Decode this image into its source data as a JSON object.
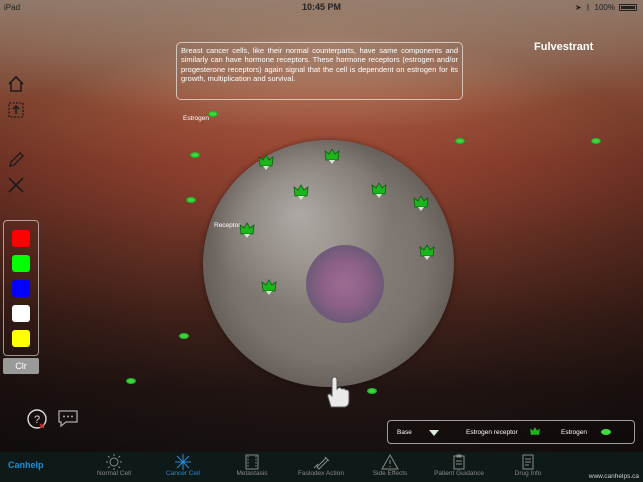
{
  "status": {
    "carrier": "iPad",
    "time": "10:45 PM",
    "battery": "100%"
  },
  "title": "Fulvestrant",
  "info_text": "Breast cancer cells, like their normal counterparts, have same components and similarly can have hormone receptors.  These hormone receptors (estrogen and/or progesterone receptors) again signal that the cell is dependent on estrogen for its growth, multiplication and survival.",
  "labels": {
    "estrogen": "Estrogen",
    "receptor": "Receptor"
  },
  "palette": {
    "colors": [
      "#ff0000",
      "#00ff00",
      "#0000ff",
      "#ffffff",
      "#ffff00"
    ],
    "clear_label": "Clr"
  },
  "legend": {
    "base": "Base",
    "receptor": "Estrogen receptor",
    "estrogen": "Estrogen"
  },
  "tabs": [
    {
      "label": "Normal Cell",
      "icon": "sun-icon",
      "active": false
    },
    {
      "label": "Cancer Cell",
      "icon": "starburst-icon",
      "active": true
    },
    {
      "label": "Metastasis",
      "icon": "film-icon",
      "active": false
    },
    {
      "label": "Faslodex Action",
      "icon": "syringe-icon",
      "active": false
    },
    {
      "label": "Side Effects",
      "icon": "warning-icon",
      "active": false
    },
    {
      "label": "Patient Guidance",
      "icon": "clipboard-icon",
      "active": false
    },
    {
      "label": "Drug Info",
      "icon": "document-icon",
      "active": false
    }
  ],
  "brand": "Canhelp",
  "website": "www.canhelps.ca",
  "accent_color": "#2a8ad8"
}
